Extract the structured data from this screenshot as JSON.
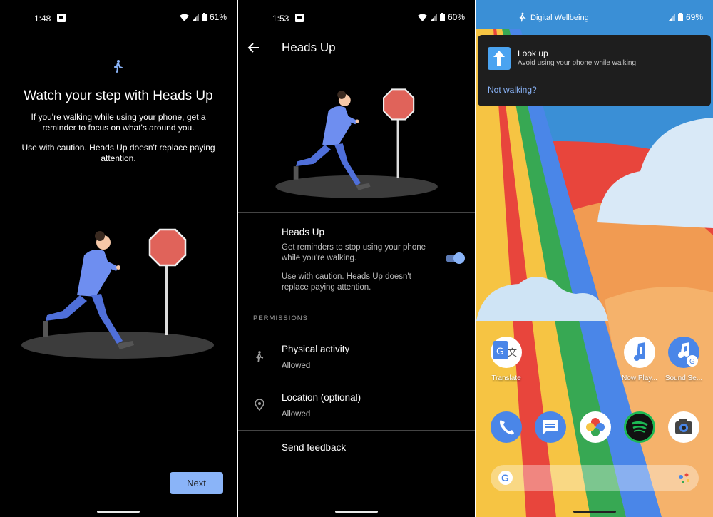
{
  "panel1": {
    "status": {
      "time": "1:48",
      "battery": "61%"
    },
    "title": "Watch your step with Heads Up",
    "body1": "If you're walking while using your phone, get a reminder to focus on what's around you.",
    "body2": "Use with caution. Heads Up doesn't replace paying attention.",
    "next_label": "Next"
  },
  "panel2": {
    "status": {
      "time": "1:53",
      "battery": "60%"
    },
    "title": "Heads Up",
    "heads_up": {
      "title": "Heads Up",
      "desc1": "Get reminders to stop using your phone while you're walking.",
      "desc2": "Use with caution. Heads Up doesn't replace paying attention.",
      "enabled": true
    },
    "permissions_header": "PERMISSIONS",
    "physical": {
      "title": "Physical activity",
      "status": "Allowed"
    },
    "location": {
      "title": "Location (optional)",
      "status": "Allowed"
    },
    "feedback": "Send feedback"
  },
  "panel3": {
    "status": {
      "app": "Digital Wellbeing",
      "battery": "69%"
    },
    "notification": {
      "title": "Look up",
      "text": "Avoid using your phone while walking",
      "action": "Not walking?"
    },
    "apps": {
      "translate": "Translate",
      "now_playing": "Now Play...",
      "sound_search": "Sound Se..."
    },
    "colors": {
      "accent": "#8ab4f8",
      "stop_sign": "#e0635a",
      "figure": "#4f6fd9"
    }
  }
}
